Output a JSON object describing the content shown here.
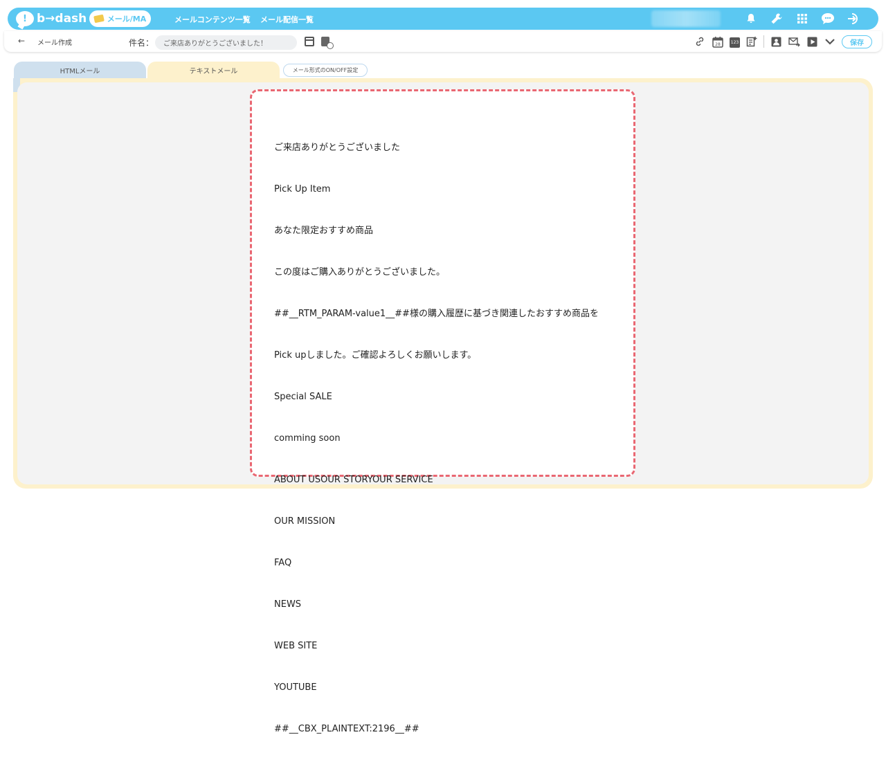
{
  "app": {
    "logo_mark": "!",
    "logo_text": "b→dash",
    "module_pill": "メール/MA",
    "nav_links": [
      "メールコンテンツ一覧",
      "メール配信一覧"
    ],
    "nav_icons": [
      "bell-icon",
      "wrench-icon",
      "grid-icon",
      "chat-icon",
      "logout-icon"
    ]
  },
  "toolbar": {
    "back_label": "←",
    "page_name": "メール作成",
    "subject_label": "件名：",
    "subject_value": "ご来店ありがとうございました！",
    "save_label": "保存",
    "right_tools": [
      "link-icon",
      "calendar-icon",
      "number-icon",
      "note-add-icon",
      "contact-icon",
      "mail-forward-icon",
      "play-icon",
      "chevron-down-icon"
    ],
    "calendar_day": "28",
    "number_badge": "123"
  },
  "tabs": {
    "html_label": "HTMLメール",
    "text_label": "テキストメール",
    "toggle_label": "メール形式のON/OFF設定"
  },
  "body_lines": [
    "ご来店ありがとうございました",
    "Pick Up Item",
    "あなた限定おすすめ商品",
    "この度はご購入ありがとうございました。",
    "##__RTM_PARAM-value1__##様の購入履歴に基づき関連したおすすめ商品を",
    "Pick upしました。ご確認よろしくお願いします。",
    "Special SALE",
    "comming soon",
    "ABOUT USOUR STORYOUR SERVICE",
    "OUR MISSION",
    "FAQ",
    "NEWS",
    "WEB SITE",
    "YOUTUBE",
    "##__CBX_PLAINTEXT:2196__##"
  ],
  "colors": {
    "brand": "#5bc8f2",
    "text_tab": "#fdf1cc",
    "html_tab": "#cfe0ee",
    "dashed_border": "#e96772"
  }
}
